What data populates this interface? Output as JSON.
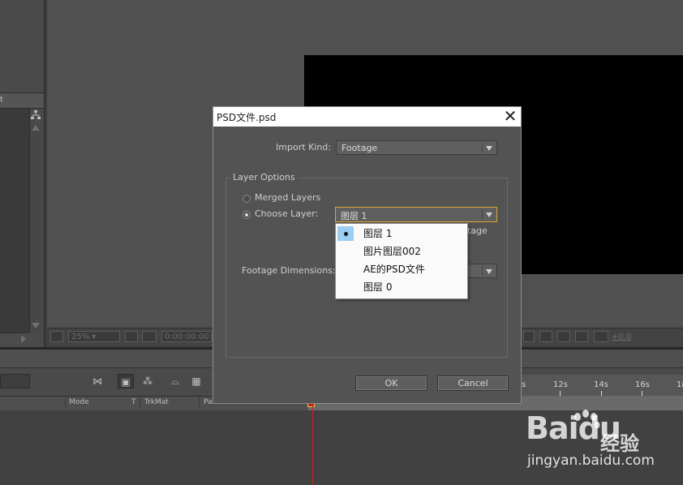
{
  "dialog": {
    "title": "PSD文件.psd",
    "import_kind_label": "Import Kind:",
    "import_kind_value": "Footage",
    "layer_options_label": "Layer Options",
    "merged_layers_label": "Merged Layers",
    "choose_layer_label": "Choose Layer:",
    "choose_layer_value": "图层 1",
    "partially_hidden_text": "tage",
    "footage_dimensions_label": "Footage Dimensions:",
    "ok_label": "OK",
    "cancel_label": "Cancel",
    "layer_menu": {
      "items": [
        "图层 1",
        "图片图层002",
        "AE的PSD文件",
        "图层 0"
      ],
      "selected": "图层 1"
    },
    "selected_radio": "choose_layer"
  },
  "left_panel": {
    "header_text": "t"
  },
  "viewer_bar": {
    "zoom": "25%",
    "timecode": "0:00:00:00",
    "exposure": "+0.0"
  },
  "timeline": {
    "columns": [
      "Mode",
      "T",
      "TrkMat",
      "Parent"
    ],
    "ruler_labels": [
      "s",
      "12s",
      "14s",
      "16s",
      "18"
    ]
  },
  "watermark": {
    "brand": "Baidu",
    "brand_cn": "经验",
    "url": "jingyan.baidu.com"
  },
  "colors": {
    "panel_bg": "#4a4a4a",
    "dialog_bg": "#535353",
    "highlight": "#9ccdf2",
    "focus_border": "#d9a635",
    "playhead": "#c2261c"
  }
}
